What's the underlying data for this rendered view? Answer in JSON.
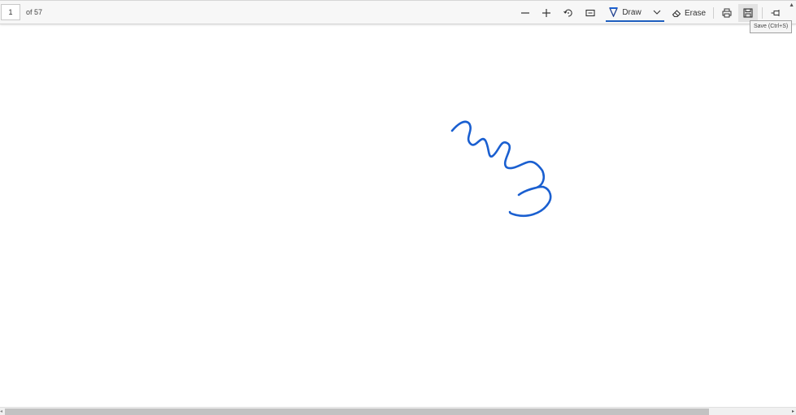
{
  "toolbar": {
    "page_number": "1",
    "page_count": "of 57",
    "draw_label": "Draw",
    "erase_label": "Erase",
    "save_tooltip": "Save (Ctrl+S)",
    "icons": {
      "zoom_out": "minus-icon",
      "zoom_in": "plus-icon",
      "rotate": "rotate-icon",
      "fit": "fit-page-icon",
      "draw": "pen-icon",
      "draw_dropdown": "chevron-down-icon",
      "erase": "eraser-icon",
      "print": "printer-icon",
      "save": "floppy-disk-icon",
      "pin": "pin-icon"
    }
  },
  "colors": {
    "ink": "#1a5fd0",
    "draw_underline": "#1f5fbf",
    "toolbar_bg": "#f7f7f7"
  },
  "scrollbar": {
    "horizontal_thumb_fraction": 0.885
  }
}
